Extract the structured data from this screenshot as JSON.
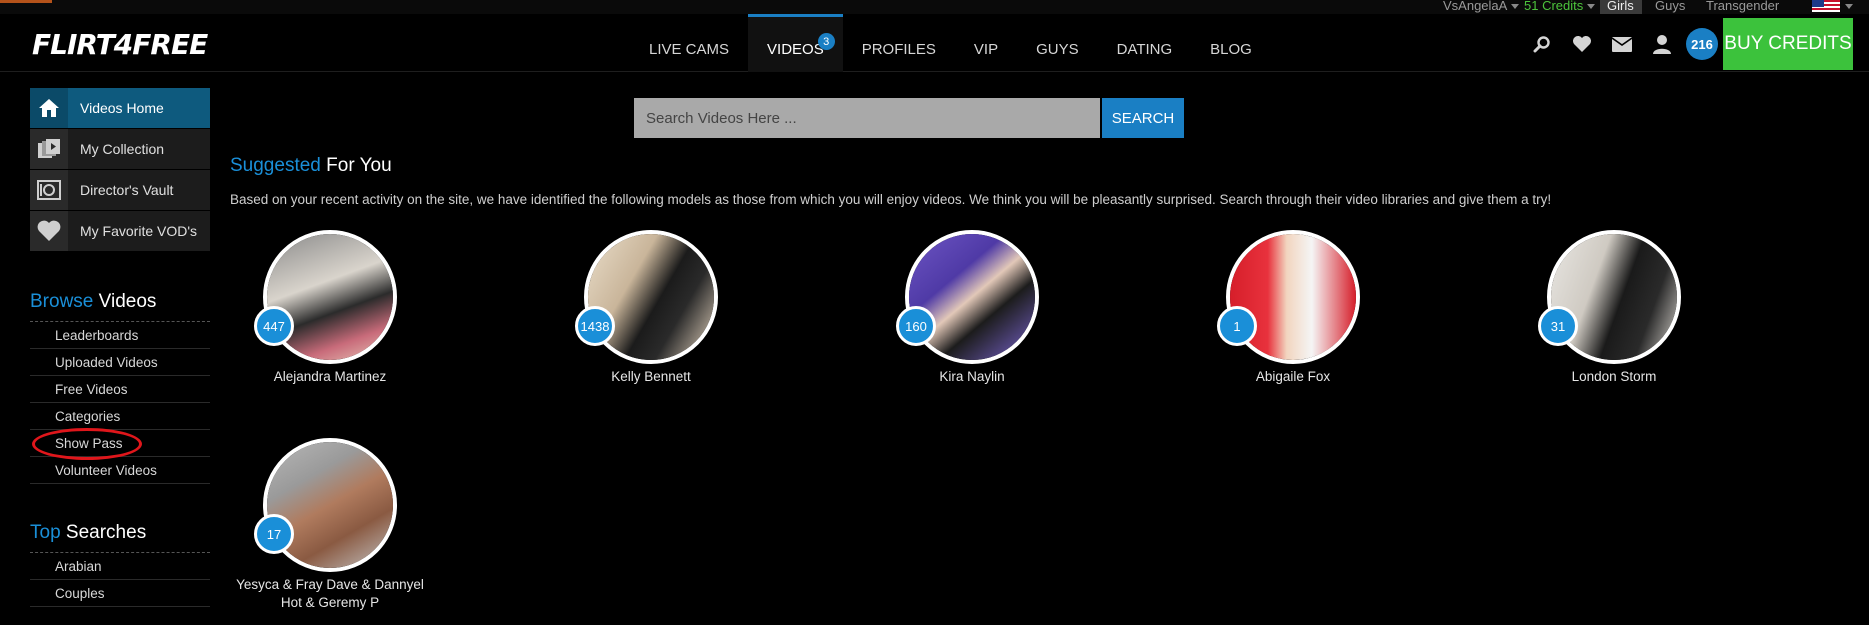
{
  "top_bar": {
    "username": "VsAngelaA",
    "credits": "51 Credits",
    "categories": [
      "Girls",
      "Guys",
      "Transgender"
    ]
  },
  "header": {
    "logo": "FLIRT4FREE",
    "nav": [
      {
        "label": "LIVE CAMS"
      },
      {
        "label": "VIDEOS",
        "badge": "3"
      },
      {
        "label": "PROFILES"
      },
      {
        "label": "VIP"
      },
      {
        "label": "GUYS"
      },
      {
        "label": "DATING"
      },
      {
        "label": "BLOG"
      }
    ],
    "icons": [
      "search-icon",
      "heart-icon",
      "mail-icon",
      "user-icon"
    ],
    "notification_count": "216",
    "buy_credits": "BUY CREDITS"
  },
  "sidebar": {
    "menu": [
      {
        "label": "Videos Home",
        "icon": "home-icon"
      },
      {
        "label": "My Collection",
        "icon": "collection-icon"
      },
      {
        "label": "Director's Vault",
        "icon": "vault-icon"
      },
      {
        "label": "My Favorite VOD's",
        "icon": "heart-icon"
      }
    ],
    "browse": {
      "title_hl": "Browse",
      "title_rest": "Videos",
      "items": [
        "Leaderboards",
        "Uploaded Videos",
        "Free Videos",
        "Categories",
        "Show Pass",
        "Volunteer Videos"
      ]
    },
    "top_searches": {
      "title_hl": "Top",
      "title_rest": "Searches",
      "items": [
        "Arabian",
        "Couples"
      ]
    }
  },
  "search": {
    "placeholder": "Search Videos Here ...",
    "button": "SEARCH"
  },
  "suggested": {
    "title_hl": "Suggested",
    "title_rest": "For You",
    "description": "Based on your recent activity on the site, we have identified the following models as those from which you will enjoy videos. We think you will be pleasantly surprised. Search through their video libraries and give them a try!",
    "models": [
      {
        "name": "Alejandra Martinez",
        "count": "447"
      },
      {
        "name": "Kelly Bennett",
        "count": "1438"
      },
      {
        "name": "Kira Naylin",
        "count": "160"
      },
      {
        "name": "Abigaile Fox",
        "count": "1"
      },
      {
        "name": "London Storm",
        "count": "31"
      },
      {
        "name": "Yesyca & Fray Dave & Dannyel Hot & Geremy P",
        "count": "17"
      }
    ]
  },
  "colors": {
    "accent_blue": "#1a7fc4",
    "buy_green": "#3cc23c",
    "credits_green": "#4cc43c",
    "annotation_red": "#e0161b"
  }
}
